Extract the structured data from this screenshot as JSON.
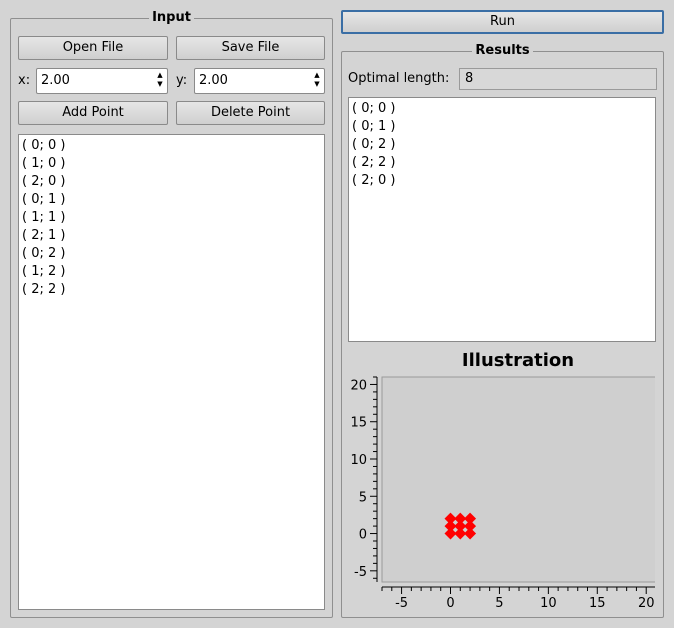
{
  "input": {
    "title": "Input",
    "open_file_label": "Open File",
    "save_file_label": "Save File",
    "x_label": "x:",
    "x_value": "2.00",
    "y_label": "y:",
    "y_value": "2.00",
    "add_point_label": "Add Point",
    "delete_point_label": "Delete Point",
    "points": [
      "( 0; 0 )",
      "( 1; 0 )",
      "( 2; 0 )",
      "( 0; 1 )",
      "( 1; 1 )",
      "( 2; 1 )",
      "( 0; 2 )",
      "( 1; 2 )",
      "( 2; 2 )"
    ]
  },
  "run_label": "Run",
  "results": {
    "title": "Results",
    "optimal_length_label": "Optimal length:",
    "optimal_length_value": "8",
    "path": [
      "( 0; 0 )",
      "( 0; 1 )",
      "( 0; 2 )",
      "( 2; 2 )",
      "( 2; 0 )"
    ]
  },
  "illustration": {
    "title": "Illustration"
  },
  "chart_data": {
    "type": "scatter",
    "title": "Illustration",
    "xlim": [
      -7,
      21
    ],
    "ylim": [
      -6.5,
      21
    ],
    "xticks": [
      -5,
      0,
      5,
      10,
      15,
      20
    ],
    "yticks": [
      -5,
      0,
      5,
      10,
      15,
      20
    ],
    "grid": false,
    "marker_color": "#ff0000",
    "marker": "diamond",
    "series": [
      {
        "x": [
          0,
          1,
          2,
          0,
          1,
          2,
          0,
          1,
          2
        ],
        "y": [
          0,
          0,
          0,
          1,
          1,
          1,
          2,
          2,
          2
        ]
      }
    ]
  }
}
